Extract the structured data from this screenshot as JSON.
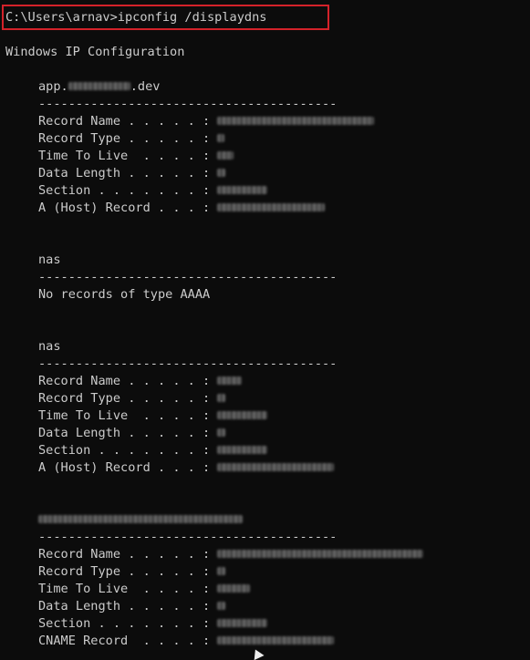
{
  "command": "C:\\Users\\arnav>ipconfig /displaydns",
  "header": "Windows IP Configuration",
  "separator": "----------------------------------------",
  "entries": [
    {
      "name_prefix": "app.",
      "name_suffix": ".dev",
      "rows": [
        {
          "label": "Record Name . . . . . : "
        },
        {
          "label": "Record Type . . . . . : "
        },
        {
          "label": "Time To Live  . . . . : "
        },
        {
          "label": "Data Length . . . . . : "
        },
        {
          "label": "Section . . . . . . . : "
        },
        {
          "label": "A (Host) Record . . . : "
        }
      ]
    },
    {
      "name": "nas",
      "message": "No records of type AAAA"
    },
    {
      "name": "nas",
      "rows": [
        {
          "label": "Record Name . . . . . : "
        },
        {
          "label": "Record Type . . . . . : "
        },
        {
          "label": "Time To Live  . . . . : "
        },
        {
          "label": "Data Length . . . . . : "
        },
        {
          "label": "Section . . . . . . . : "
        },
        {
          "label": "A (Host) Record . . . : "
        }
      ]
    },
    {
      "rows": [
        {
          "label": "Record Name . . . . . : "
        },
        {
          "label": "Record Type . . . . . : "
        },
        {
          "label": "Time To Live  . . . . : "
        },
        {
          "label": "Data Length . . . . . : "
        },
        {
          "label": "Section . . . . . . . : "
        },
        {
          "label": "CNAME Record  . . . . : "
        }
      ]
    }
  ]
}
